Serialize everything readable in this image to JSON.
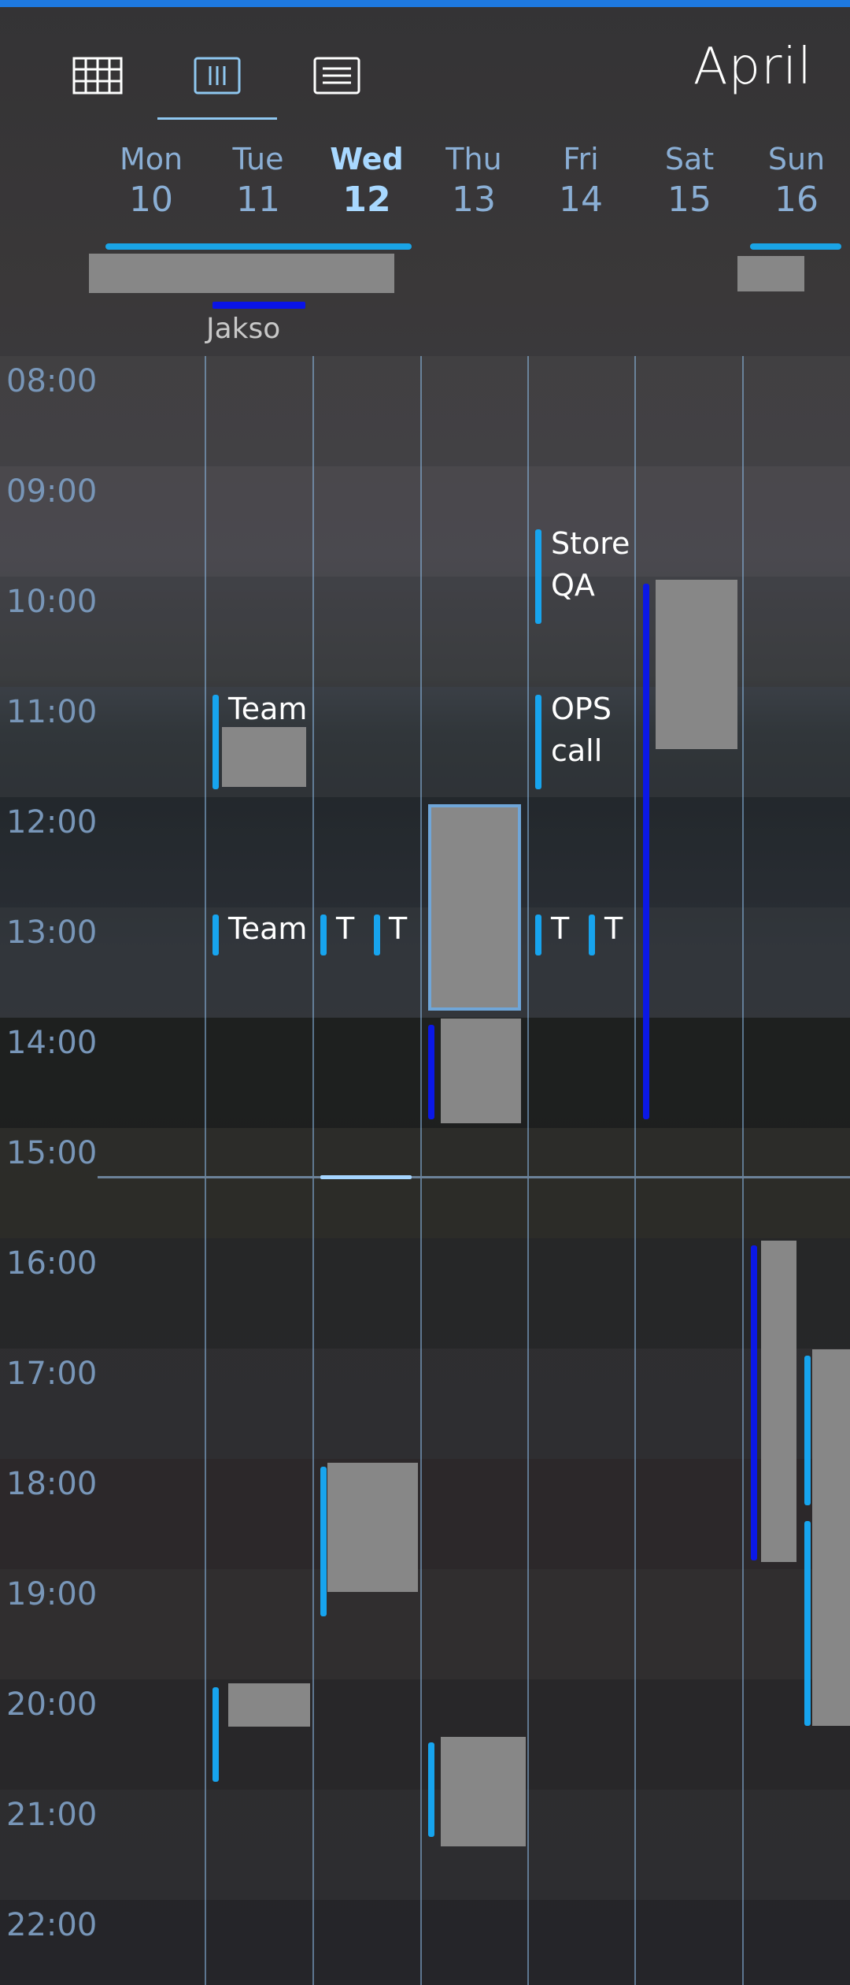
{
  "header": {
    "month": "April",
    "views": [
      {
        "name": "month-view",
        "icon": "grid-icon"
      },
      {
        "name": "week-view",
        "icon": "columns-icon"
      },
      {
        "name": "agenda-view",
        "icon": "list-icon"
      }
    ],
    "active_view": "week-view"
  },
  "days": [
    {
      "name": "Mon",
      "num": "10"
    },
    {
      "name": "Tue",
      "num": "11"
    },
    {
      "name": "Wed",
      "num": "12",
      "today": true
    },
    {
      "name": "Thu",
      "num": "13"
    },
    {
      "name": "Fri",
      "num": "14"
    },
    {
      "name": "Sat",
      "num": "15"
    },
    {
      "name": "Sun",
      "num": "16"
    }
  ],
  "allday": {
    "period_label": "Jakso"
  },
  "hours": [
    "08:00",
    "09:00",
    "10:00",
    "11:00",
    "12:00",
    "13:00",
    "14:00",
    "15:00",
    "16:00",
    "17:00",
    "18:00",
    "19:00",
    "20:00",
    "21:00",
    "22:00"
  ],
  "events": {
    "tue_team_1": "Team",
    "tue_team_2": "Team",
    "wed_t": "T",
    "wed_t2": "T",
    "fri_store": "Store QA",
    "fri_ops": "OPS call",
    "fri_t": "T",
    "fri_t2": "T"
  },
  "colors": {
    "accent": "#17a4ee",
    "dark_accent": "#0b18e6",
    "event_block": "#878787",
    "hour_label": "#7896b8",
    "day_label": "#8aaed4",
    "today_label": "#a8d8ff"
  }
}
